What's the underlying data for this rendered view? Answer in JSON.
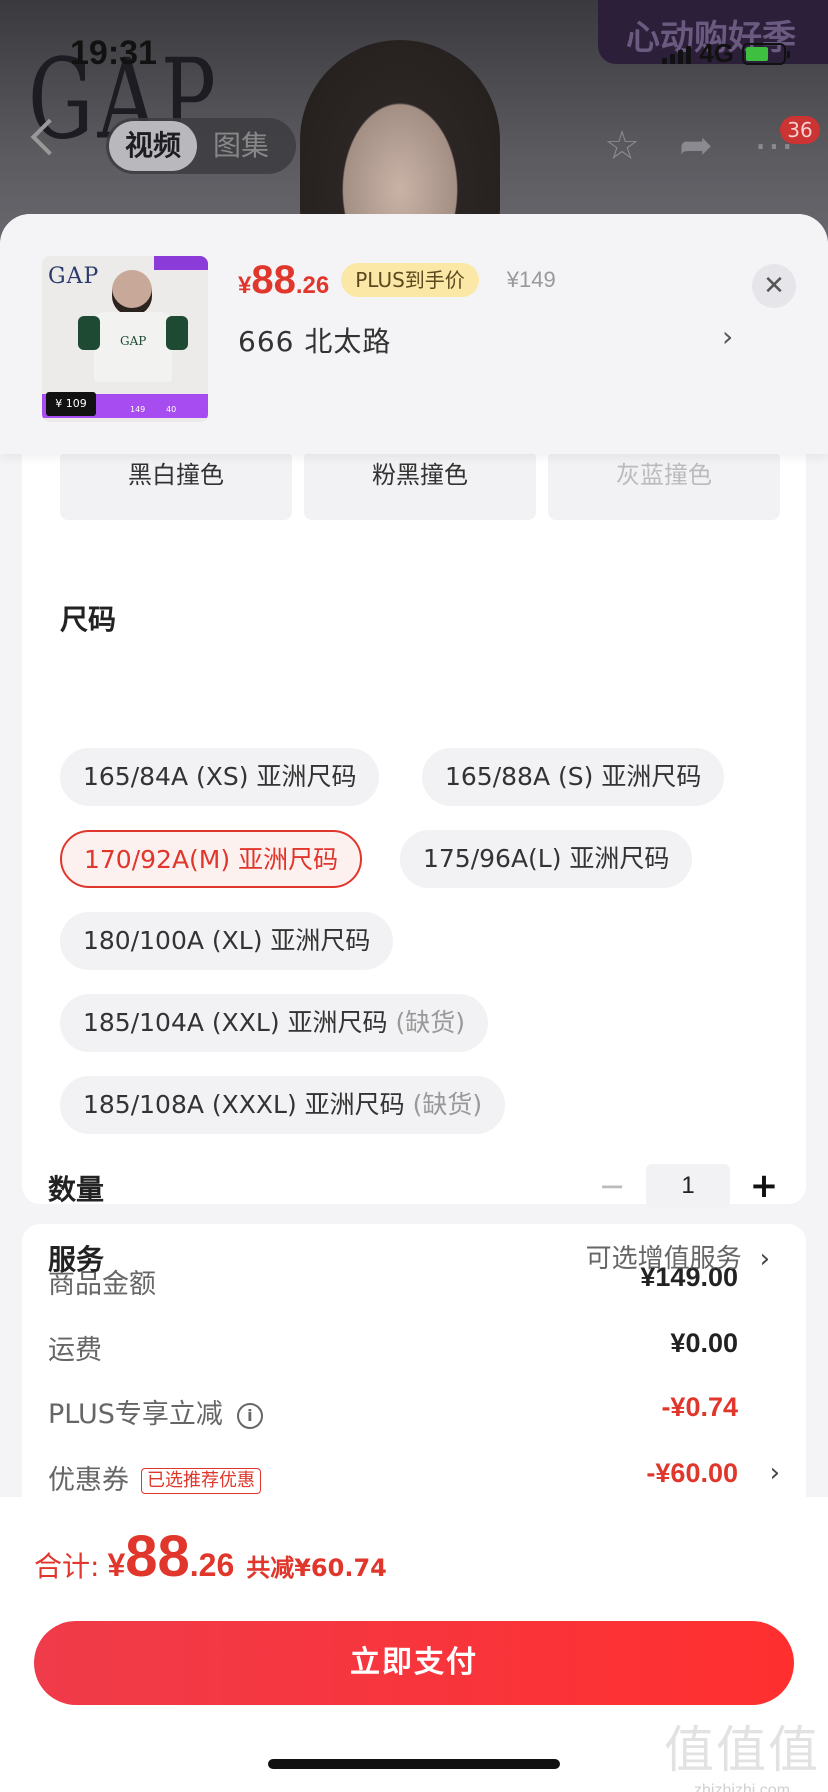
{
  "status_bar": {
    "time": "19:31",
    "network": "4G"
  },
  "background": {
    "brand_logo": "GAP",
    "banner_text": "心动购好季",
    "tabs": [
      {
        "label": "视频",
        "active": true
      },
      {
        "label": "图集",
        "active": false
      }
    ],
    "cart_badge": "36"
  },
  "product": {
    "price_symbol": "¥",
    "price_int": "88",
    "price_dec": ".26",
    "plus_label": "PLUS到手价",
    "original_price": "¥149",
    "variant": "666  北太路",
    "thumb": {
      "price": "¥ 109",
      "left_value": "149",
      "right_value": "40"
    }
  },
  "colors": [
    {
      "label": "黑白撞色",
      "disabled": false
    },
    {
      "label": "粉黑撞色",
      "disabled": false
    },
    {
      "label": "灰蓝撞色",
      "disabled": true
    }
  ],
  "size": {
    "title": "尺码",
    "options": [
      {
        "label": "165/84A (XS) 亚洲尺码",
        "oos": "",
        "selected": false
      },
      {
        "label": "165/88A (S) 亚洲尺码",
        "oos": "",
        "selected": false
      },
      {
        "label": "170/92A(M) 亚洲尺码",
        "oos": "",
        "selected": true
      },
      {
        "label": "175/96A(L) 亚洲尺码",
        "oos": "",
        "selected": false
      },
      {
        "label": "180/100A (XL) 亚洲尺码",
        "oos": "",
        "selected": false
      },
      {
        "label": "185/104A (XXL) 亚洲尺码",
        "oos": "(缺货)",
        "selected": false
      },
      {
        "label": "185/108A (XXXL) 亚洲尺码",
        "oos": "(缺货)",
        "selected": false
      }
    ]
  },
  "quantity": {
    "label": "数量",
    "value": "1",
    "minus": "−",
    "plus": "+"
  },
  "service": {
    "label": "服务",
    "value": "可选增值服务",
    "chevron": "›"
  },
  "summary": {
    "goods_label": "商品金额",
    "goods_value": "¥149.00",
    "shipping_label": "运费",
    "shipping_value": "¥0.00",
    "plus_label": "PLUS专享立减",
    "plus_value": "-¥0.74",
    "coupon_label": "优惠券",
    "coupon_tag": "已选推荐优惠",
    "coupon_value": "-¥60.00"
  },
  "total": {
    "label": "合计:",
    "symbol": "¥",
    "int": "88",
    "dec": ".26",
    "saved": "共减¥60.74"
  },
  "pay_button": "立即支付",
  "watermark": {
    "big": "值值值",
    "small": "zhizhizhi.com"
  },
  "colors_theme": {
    "accent": "#e0362c",
    "plus_badge": "#fbe7a6"
  }
}
